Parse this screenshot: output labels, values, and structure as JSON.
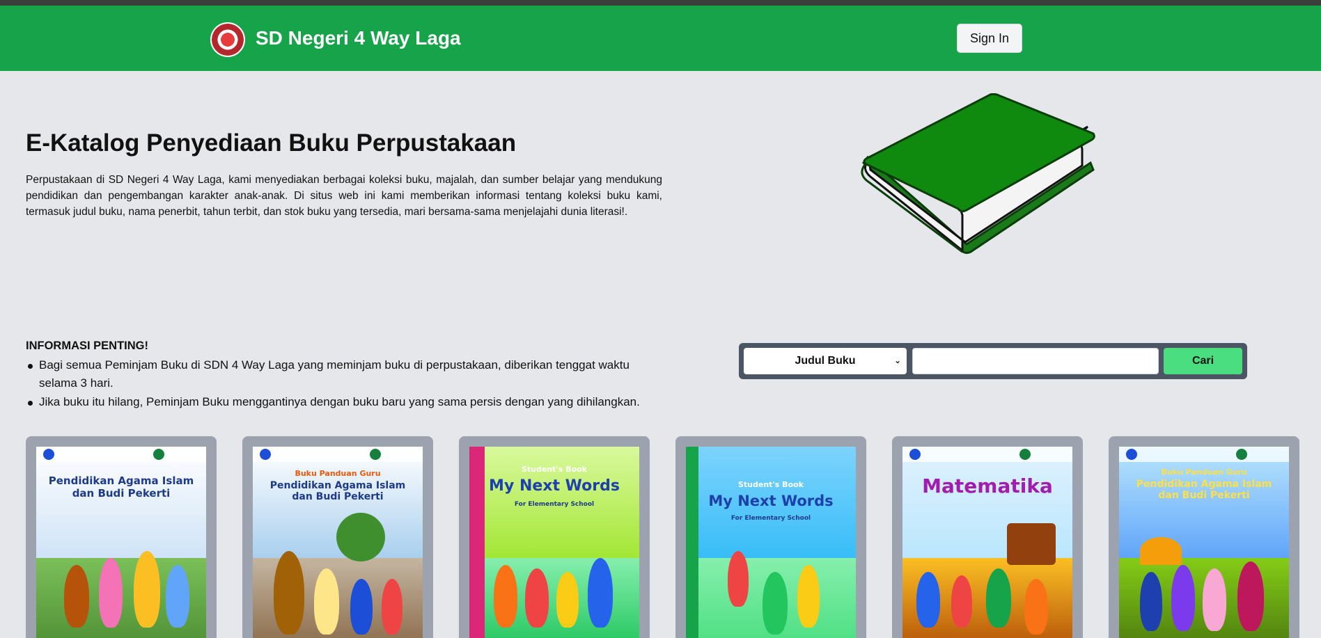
{
  "header": {
    "brand": "SD Negeri 4 Way Laga",
    "sign_in_label": "Sign In",
    "accent_color": "#16a34a"
  },
  "hero": {
    "title": "E-Katalog Penyediaan Buku Perpustakaan",
    "description": "Perpustakaan di SD Negeri 4 Way Laga, kami menyediakan berbagai koleksi buku, majalah, dan sumber belajar yang mendukung pendidikan dan pengembangan karakter anak-anak. Di situs web ini kami memberikan informasi tentang koleksi buku kami, termasuk judul buku, nama penerbit, tahun terbit, dan stok buku yang tersedia, mari bersama-sama menjelajahi dunia literasi!.",
    "illustration": "book-illustration"
  },
  "info": {
    "title": "INFORMASI PENTING!",
    "items": [
      "Bagi semua Peminjam Buku di SDN 4 Way Laga yang meminjam buku di perpustakaan, diberikan tenggat waktu selama 3 hari.",
      "Jika buku itu hilang, Peminjam Buku menggantinya dengan buku baru yang sama persis dengan yang dihilangkan."
    ]
  },
  "search": {
    "select_value": "Judul Buku",
    "input_value": "",
    "button_label": "Cari"
  },
  "books": [
    {
      "cover_title": "Pendidikan Agama Islam dan Budi Pekerti",
      "cover_subtitle": ""
    },
    {
      "cover_title": "Pendidikan Agama Islam dan Budi Pekerti",
      "cover_subtitle": "Buku Panduan Guru"
    },
    {
      "cover_title": "My Next Words",
      "cover_subtitle": "Student's Book",
      "cover_tag": "For Elementary School"
    },
    {
      "cover_title": "My Next Words",
      "cover_subtitle": "Student's Book",
      "cover_tag": "For Elementary School"
    },
    {
      "cover_title": "Matematika",
      "cover_subtitle": ""
    },
    {
      "cover_title": "Pendidikan Agama Islam dan Budi Pekerti",
      "cover_subtitle": "Buku Panduan Guru"
    }
  ]
}
